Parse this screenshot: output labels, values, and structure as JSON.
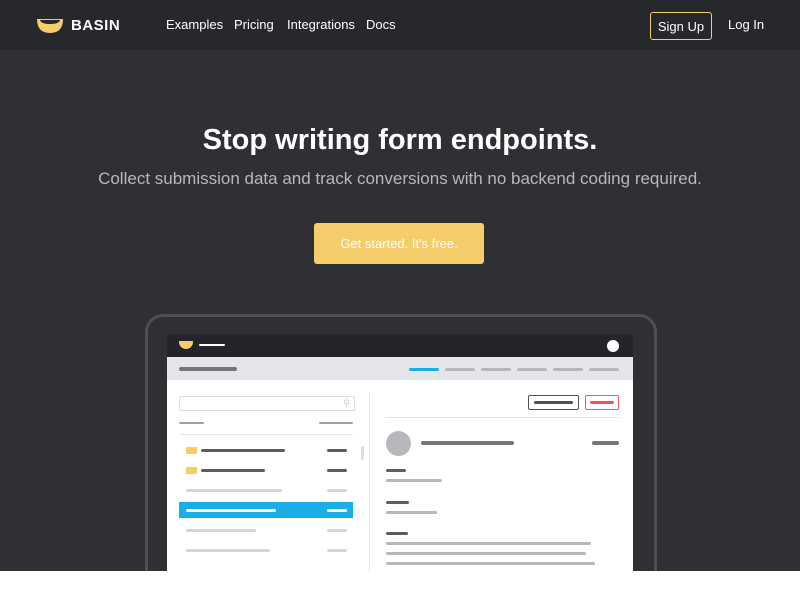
{
  "brand": {
    "name": "BASIN",
    "logo_color": "#f5cd6a"
  },
  "nav": {
    "items": [
      "Examples",
      "Pricing",
      "Integrations",
      "Docs"
    ]
  },
  "auth": {
    "sign_up": "Sign Up",
    "log_in": "Log In"
  },
  "hero": {
    "headline": "Stop writing form endpoints.",
    "subheadline": "Collect submission data and track conversions with no backend coding required.",
    "cta": "Get started. It's free."
  },
  "colors": {
    "background": "#2f3034",
    "topbar": "#27282b",
    "accent": "#f5cd6a",
    "highlight": "#18aee6",
    "danger": "#f0555a"
  },
  "mockup": {
    "active_tab_index": 0,
    "selected_row_index": 3,
    "icons": [
      "search-icon",
      "folder-icon",
      "avatar-icon"
    ]
  }
}
